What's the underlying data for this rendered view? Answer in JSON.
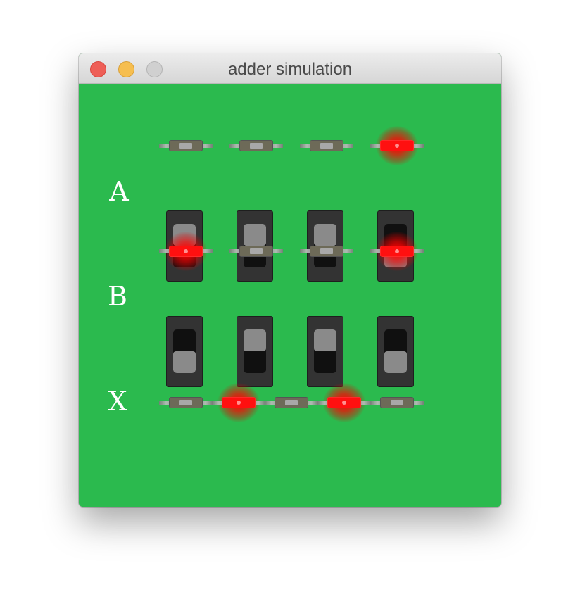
{
  "window": {
    "title": "adder simulation"
  },
  "rows": {
    "a": {
      "label": "A",
      "leds": [
        false,
        false,
        false,
        true
      ],
      "switches": [
        false,
        false,
        false,
        true
      ]
    },
    "b": {
      "label": "B",
      "leds": [
        true,
        false,
        false,
        true
      ],
      "switches": [
        true,
        false,
        false,
        true
      ]
    },
    "x": {
      "label": "X",
      "leds": [
        false,
        true,
        false,
        true,
        false
      ]
    }
  },
  "colors": {
    "board": "#2bba4e",
    "led_on": "#ff1010",
    "led_off": "#6d6a58",
    "switch_body": "#333333"
  }
}
